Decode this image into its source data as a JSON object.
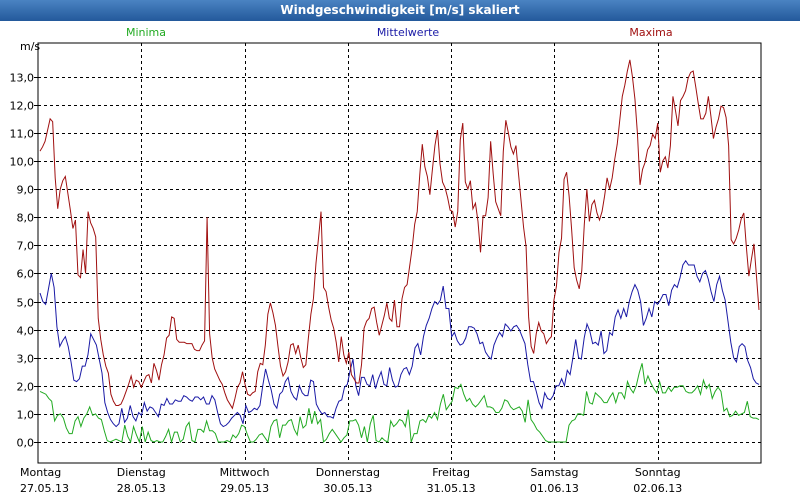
{
  "window": {
    "title": "Windgeschwindigkeit [m/s] skaliert"
  },
  "colors": {
    "minima": "#22aa22",
    "mittelwerte": "#1a1aa6",
    "maxima": "#a01010",
    "grid": "#000000",
    "titlebar": "#2d64a8"
  },
  "chart_data": {
    "type": "line",
    "title": "Windgeschwindigkeit [m/s] skaliert",
    "ylabel": "m/s",
    "ylim": [
      -0.35,
      14.1
    ],
    "yticks": [
      "0,0",
      "1,0",
      "2,0",
      "3,0",
      "4,0",
      "5,0",
      "6,0",
      "7,0",
      "8,0",
      "9,0",
      "10,0",
      "11,0",
      "12,0",
      "13,0"
    ],
    "xticks": [
      {
        "day": "Montag",
        "date": "27.05.13"
      },
      {
        "day": "Dienstag",
        "date": "28.05.13"
      },
      {
        "day": "Mittwoch",
        "date": "29.05.13"
      },
      {
        "day": "Donnerstag",
        "date": "30.05.13"
      },
      {
        "day": "Freitag",
        "date": "31.05.13"
      },
      {
        "day": "Samstag",
        "date": "01.06.13"
      },
      {
        "day": "Sonntag",
        "date": "02.06.13"
      }
    ],
    "grid": true,
    "legend_position": "top",
    "series": [
      {
        "name": "Minima",
        "values": [
          1.8,
          1.75,
          1.7,
          1.55,
          1.45,
          0.75,
          0.95,
          1.0,
          0.85,
          0.5,
          0.3,
          0.3,
          0.75,
          0.9,
          0.55,
          0.85,
          1.0,
          1.25,
          0.95,
          1.0,
          0.85,
          0.8,
          0.4,
          0.05,
          0.0,
          0.05,
          0.1,
          0.05,
          0.0,
          0.6,
          0.2,
          0.0,
          0.55,
          0.25,
          0.0,
          0.55,
          0.0,
          0.35,
          0.05,
          0.0,
          0.05,
          0.0,
          0.0,
          0.2,
          0.45,
          0.0,
          0.35,
          0.35,
          0.0,
          0.1,
          0.55,
          0.7,
          0.05,
          0.0,
          0.45,
          0.45,
          0.35,
          0.75,
          0.4,
          0.4,
          0.3,
          0.0,
          0.0,
          0.0,
          0.05,
          0.0,
          0.25,
          0.15,
          0.3,
          0.6,
          0.55,
          0.25,
          0.0,
          0.0,
          0.1,
          0.25,
          0.3,
          0.15,
          0.0,
          0.55,
          0.75,
          0.8,
          0.15,
          0.6,
          0.6,
          0.75,
          0.8,
          0.45,
          0.25,
          0.9,
          0.5,
          0.6,
          1.2,
          0.65,
          1.1,
          0.65,
          0.8,
          0.0,
          0.1,
          0.3,
          0.45,
          0.3,
          0.15,
          0.0,
          0.15,
          0.25,
          0.75,
          0.75,
          0.8,
          0.6,
          0.15,
          0.55,
          0.0,
          0.65,
          0.95,
          0.05,
          0.0,
          0.15,
          0.05,
          0.0,
          0.75,
          0.55,
          0.65,
          0.8,
          0.75,
          0.55,
          1.15,
          0.0,
          0.3,
          0.3,
          0.75,
          0.8,
          0.7,
          0.95,
          0.85,
          1.05,
          0.8,
          1.35,
          1.7,
          1.15,
          1.3,
          1.45,
          1.95,
          1.9,
          2.05,
          1.7,
          1.45,
          1.55,
          1.35,
          1.25,
          1.35,
          1.5,
          1.65,
          1.25,
          1.25,
          1.2,
          1.05,
          1.05,
          1.2,
          1.5,
          1.45,
          1.25,
          1.15,
          1.2,
          1.25,
          1.1,
          0.7,
          1.5,
          0.8,
          0.65,
          0.45,
          0.35,
          0.2,
          0.05,
          0.0,
          0.0,
          0.0,
          0.0,
          0.0,
          0.0,
          0.0,
          0.6,
          0.75,
          0.8,
          1.0,
          1.0,
          0.95,
          1.8,
          1.4,
          1.35,
          1.75,
          1.65,
          1.55,
          1.4,
          1.4,
          1.6,
          1.75,
          1.4,
          1.75,
          1.75,
          1.55,
          2.15,
          1.9,
          1.75,
          2.0,
          2.45,
          2.8,
          2.05,
          2.35,
          2.1,
          1.9,
          1.75,
          2.15,
          1.75,
          1.75,
          1.95,
          1.8,
          1.95,
          1.95,
          2.0,
          2.0,
          1.8,
          1.75,
          1.75,
          1.85,
          2.0,
          1.7,
          2.2,
          1.9,
          2.05,
          1.55,
          1.8,
          1.95,
          1.8,
          1.1,
          1.2,
          0.9,
          0.95,
          1.1,
          0.95,
          1.0,
          1.05,
          1.45,
          0.9,
          0.85,
          0.85,
          0.8
        ]
      },
      {
        "name": "Mittelwerte",
        "values": [
          5.3,
          5.0,
          4.9,
          5.45,
          6.0,
          5.5,
          4.1,
          3.4,
          3.6,
          3.75,
          3.4,
          2.85,
          2.2,
          2.15,
          2.25,
          2.7,
          2.7,
          3.1,
          3.85,
          3.65,
          3.45,
          2.95,
          2.45,
          1.4,
          1.05,
          0.8,
          0.65,
          0.55,
          0.65,
          1.2,
          0.7,
          0.85,
          1.3,
          0.9,
          0.75,
          1.05,
          0.95,
          1.4,
          1.1,
          1.25,
          1.2,
          1.05,
          0.9,
          1.35,
          1.3,
          1.55,
          1.35,
          1.35,
          1.5,
          1.45,
          1.45,
          1.65,
          1.6,
          1.5,
          1.45,
          1.6,
          1.6,
          1.5,
          1.6,
          1.35,
          1.35,
          1.65,
          1.5,
          1.05,
          0.65,
          0.55,
          0.6,
          0.7,
          0.85,
          0.95,
          1.05,
          0.95,
          0.65,
          1.3,
          1.05,
          1.1,
          1.2,
          1.15,
          1.3,
          2.0,
          2.6,
          2.2,
          1.85,
          1.35,
          1.2,
          1.7,
          1.8,
          2.15,
          2.3,
          1.8,
          1.6,
          1.5,
          2.0,
          1.75,
          1.65,
          1.65,
          2.2,
          2.15,
          1.35,
          1.15,
          1.0,
          1.05,
          0.9,
          0.9,
          0.85,
          1.2,
          1.45,
          1.5,
          1.95,
          2.05,
          2.55,
          2.95,
          2.0,
          1.65,
          2.3,
          2.3,
          2.05,
          2.0,
          2.4,
          1.9,
          2.25,
          2.5,
          2.05,
          2.0,
          2.65,
          2.2,
          1.95,
          2.0,
          2.4,
          2.6,
          2.65,
          2.4,
          2.7,
          3.35,
          3.5,
          3.1,
          3.75,
          4.15,
          4.4,
          4.75,
          5.0,
          4.9,
          5.05,
          5.55,
          4.75,
          4.75,
          3.75,
          3.9,
          3.6,
          3.45,
          3.5,
          3.7,
          4.1,
          4.1,
          4.05,
          3.85,
          3.5,
          3.55,
          3.2,
          3.05,
          2.95,
          3.45,
          3.7,
          3.9,
          3.75,
          4.2,
          4.1,
          3.95,
          4.1,
          4.15,
          4.0,
          3.75,
          3.5,
          2.75,
          2.15,
          2.15,
          1.8,
          1.4,
          1.2,
          1.75,
          1.55,
          1.5,
          1.65,
          2.0,
          2.0,
          2.25,
          2.0,
          2.55,
          2.4,
          3.0,
          3.65,
          3.0,
          2.95,
          3.7,
          4.2,
          3.95,
          3.5,
          3.55,
          3.45,
          3.95,
          3.15,
          3.25,
          3.9,
          3.8,
          4.45,
          4.7,
          4.4,
          4.75,
          4.45,
          5.0,
          5.35,
          5.6,
          5.4,
          5.0,
          4.15,
          4.4,
          4.75,
          4.45,
          5.0,
          4.9,
          5.05,
          5.25,
          5.25,
          4.85,
          5.4,
          5.6,
          5.5,
          5.85,
          6.3,
          6.45,
          6.3,
          6.3,
          6.3,
          5.9,
          5.7,
          6.0,
          6.1,
          5.8,
          5.35,
          5.0,
          5.6,
          5.9,
          5.4,
          5.05,
          4.3,
          3.55,
          3.0,
          2.85,
          3.4,
          3.5,
          3.4,
          2.9,
          2.65,
          2.25,
          2.1,
          2.05
        ]
      },
      {
        "name": "Maxima",
        "values": [
          10.35,
          10.5,
          10.7,
          11.1,
          11.5,
          11.4,
          9.4,
          8.3,
          9.0,
          9.3,
          9.45,
          8.85,
          8.25,
          7.6,
          7.9,
          5.95,
          5.85,
          6.85,
          6.0,
          8.2,
          7.8,
          7.6,
          7.3,
          4.4,
          3.65,
          3.1,
          2.7,
          2.45,
          1.7,
          1.45,
          1.3,
          1.3,
          1.35,
          1.55,
          1.8,
          2.05,
          2.35,
          1.95,
          2.2,
          2.15,
          1.95,
          2.15,
          2.35,
          2.4,
          2.1,
          2.8,
          2.55,
          2.2,
          2.75,
          3.1,
          3.7,
          3.8,
          4.45,
          4.4,
          3.65,
          3.55,
          3.55,
          3.55,
          3.5,
          3.5,
          3.5,
          3.3,
          3.25,
          3.25,
          3.45,
          3.6,
          8.0,
          3.85,
          3.0,
          2.6,
          2.4,
          2.2,
          2.05,
          1.75,
          1.5,
          1.35,
          1.2,
          1.55,
          1.95,
          2.1,
          2.5,
          2.05,
          1.7,
          1.65,
          1.75,
          1.8,
          2.5,
          2.8,
          2.75,
          3.45,
          4.55,
          4.95,
          4.6,
          4.15,
          3.4,
          2.7,
          2.35,
          2.5,
          2.85,
          3.45,
          3.5,
          3.15,
          3.45,
          3.0,
          2.65,
          2.75,
          3.7,
          4.55,
          5.1,
          6.35,
          7.25,
          8.2,
          5.5,
          5.35,
          4.8,
          4.35,
          4.05,
          3.55,
          2.85,
          3.75,
          3.1,
          2.8,
          3.2,
          2.4,
          2.25,
          2.1,
          2.1,
          2.75,
          4.05,
          4.3,
          4.4,
          4.75,
          4.8,
          4.25,
          3.8,
          4.15,
          4.5,
          4.95,
          4.4,
          4.3,
          5.05,
          4.1,
          4.1,
          5.1,
          5.5,
          5.6,
          6.25,
          6.9,
          7.75,
          8.2,
          9.5,
          10.6,
          9.8,
          9.45,
          8.8,
          9.7,
          10.55,
          11.1,
          9.9,
          9.25,
          9.05,
          8.7,
          8.25,
          8.2,
          7.65,
          8.2,
          10.75,
          11.35,
          9.25,
          9.0,
          9.3,
          8.3,
          8.5,
          7.85,
          6.75,
          8.05,
          8.05,
          8.7,
          10.7,
          9.55,
          8.55,
          8.3,
          8.05,
          10.35,
          11.45,
          11.0,
          10.5,
          10.25,
          10.55,
          9.55,
          8.6,
          7.65,
          6.95,
          4.45,
          3.4,
          3.15,
          3.85,
          4.25,
          3.95,
          3.85,
          3.5,
          3.65,
          3.75,
          5.05,
          5.55,
          6.75,
          7.25,
          9.35,
          9.6,
          8.75,
          7.55,
          6.2,
          5.75,
          5.45,
          6.1,
          7.75,
          9.0,
          7.85,
          8.45,
          8.6,
          8.15,
          7.9,
          8.2,
          8.75,
          9.4,
          9.0,
          9.4,
          10.05,
          10.6,
          11.45,
          12.3,
          12.7,
          13.2,
          13.6,
          13.0,
          12.2,
          10.95,
          9.15,
          9.7,
          9.95,
          10.4,
          10.55,
          10.95,
          10.8,
          11.35,
          9.6,
          10.0,
          10.15,
          9.75,
          10.55,
          12.3,
          11.8,
          11.25,
          12.15,
          12.3,
          12.5,
          12.95,
          13.15,
          13.2,
          12.65,
          12.05,
          11.5,
          11.5,
          11.7,
          12.3,
          11.6,
          10.8,
          11.2,
          11.5,
          11.95,
          11.9,
          11.55,
          10.55,
          7.2,
          7.05,
          7.25,
          7.55,
          7.95,
          8.15,
          6.95,
          5.9,
          6.5,
          7.05,
          5.9,
          4.7
        ]
      }
    ]
  }
}
